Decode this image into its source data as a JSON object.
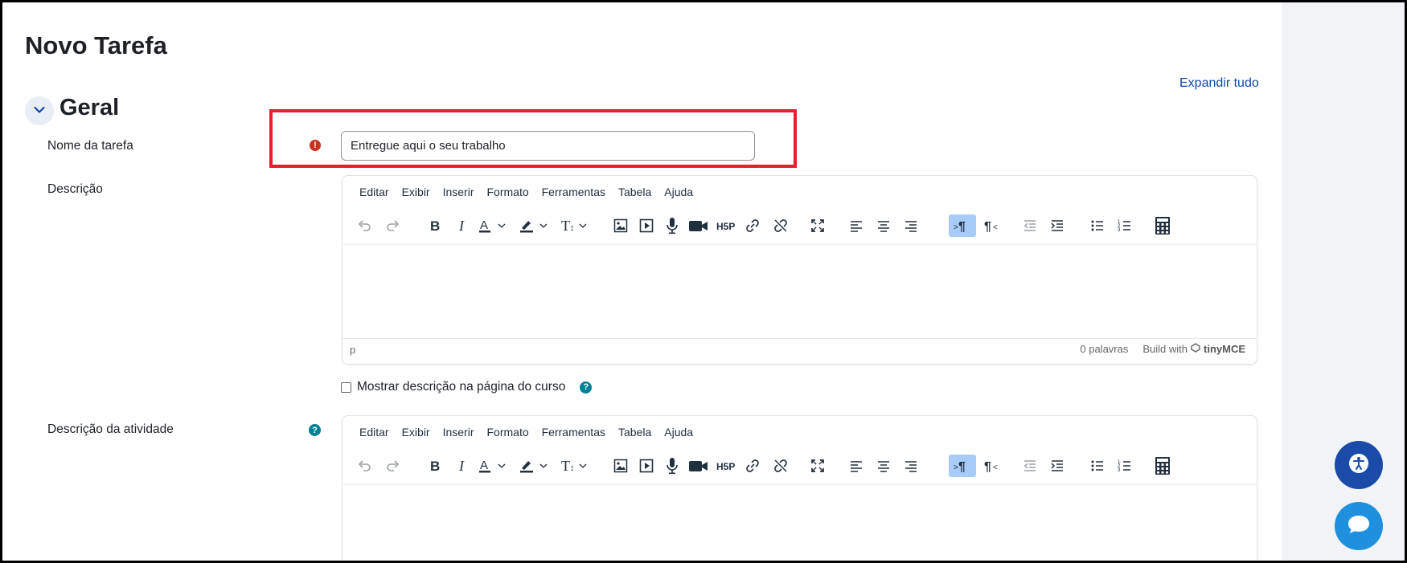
{
  "page": {
    "title": "Novo Tarefa",
    "expand_all": "Expandir tudo"
  },
  "section": {
    "title": "Geral"
  },
  "fields": {
    "name_label": "Nome da tarefa",
    "name_value": "Entregue aqui o seu trabalho",
    "description_label": "Descrição",
    "activity_label": "Descrição da atividade",
    "show_description_label": "Mostrar descrição na página do curso"
  },
  "editor": {
    "menus": [
      "Editar",
      "Exibir",
      "Inserir",
      "Formato",
      "Ferramentas",
      "Tabela",
      "Ajuda"
    ],
    "status_path": "p",
    "word_count": "0 palavras",
    "build_with": "Build with",
    "brand": "tinyMCE"
  },
  "colors": {
    "accent": "#0f47ad",
    "highlight_border": "#e3202b",
    "error": "#ca3120",
    "help": "#008196",
    "fab_accessibility": "#1a4ba8",
    "fab_chat": "#1e90dd"
  },
  "icons": {
    "error": "exclamation-circle-icon",
    "help": "question-circle-icon",
    "collapse": "chevron-down-icon",
    "accessibility": "accessibility-icon",
    "chat": "chat-bubble-icon"
  }
}
